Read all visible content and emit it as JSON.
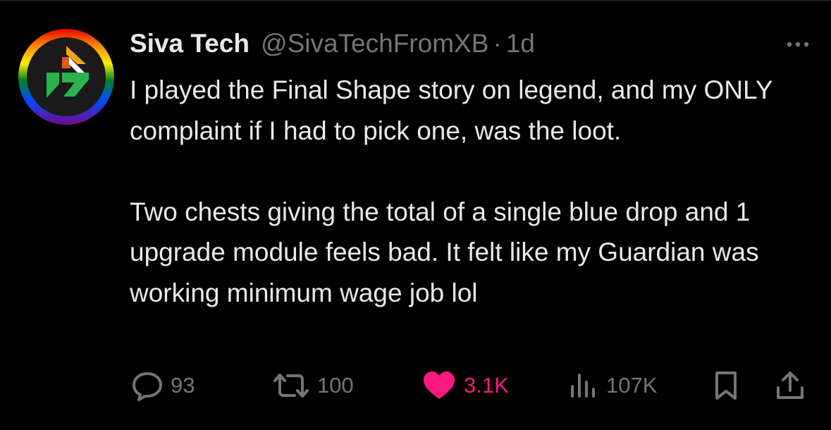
{
  "tweet": {
    "author": {
      "display_name": "Siva Tech",
      "handle": "@SivaTechFromXB",
      "separator": "·",
      "time": "1d",
      "avatar_icon": "rainbow-ring-logo-icon"
    },
    "paragraphs": [
      "I played the Final Shape story on legend, and my ONLY complaint if I had to pick one, was the loot.",
      "Two chests giving the total of a single blue drop and 1 upgrade module feels bad. It felt like my Guardian was working minimum wage job lol"
    ],
    "actions": {
      "reply": {
        "icon": "reply-icon",
        "count": "93"
      },
      "retweet": {
        "icon": "retweet-icon",
        "count": "100"
      },
      "like": {
        "icon": "heart-icon",
        "count": "3.1K",
        "active": true,
        "color": "#f91880"
      },
      "views": {
        "icon": "views-icon",
        "count": "107K"
      },
      "bookmark": {
        "icon": "bookmark-icon"
      },
      "share": {
        "icon": "share-icon"
      }
    },
    "more_icon": "more-options-icon"
  },
  "colors": {
    "background": "#000000",
    "text_primary": "#e7e9ea",
    "text_secondary": "#71767b",
    "like": "#f91880"
  }
}
